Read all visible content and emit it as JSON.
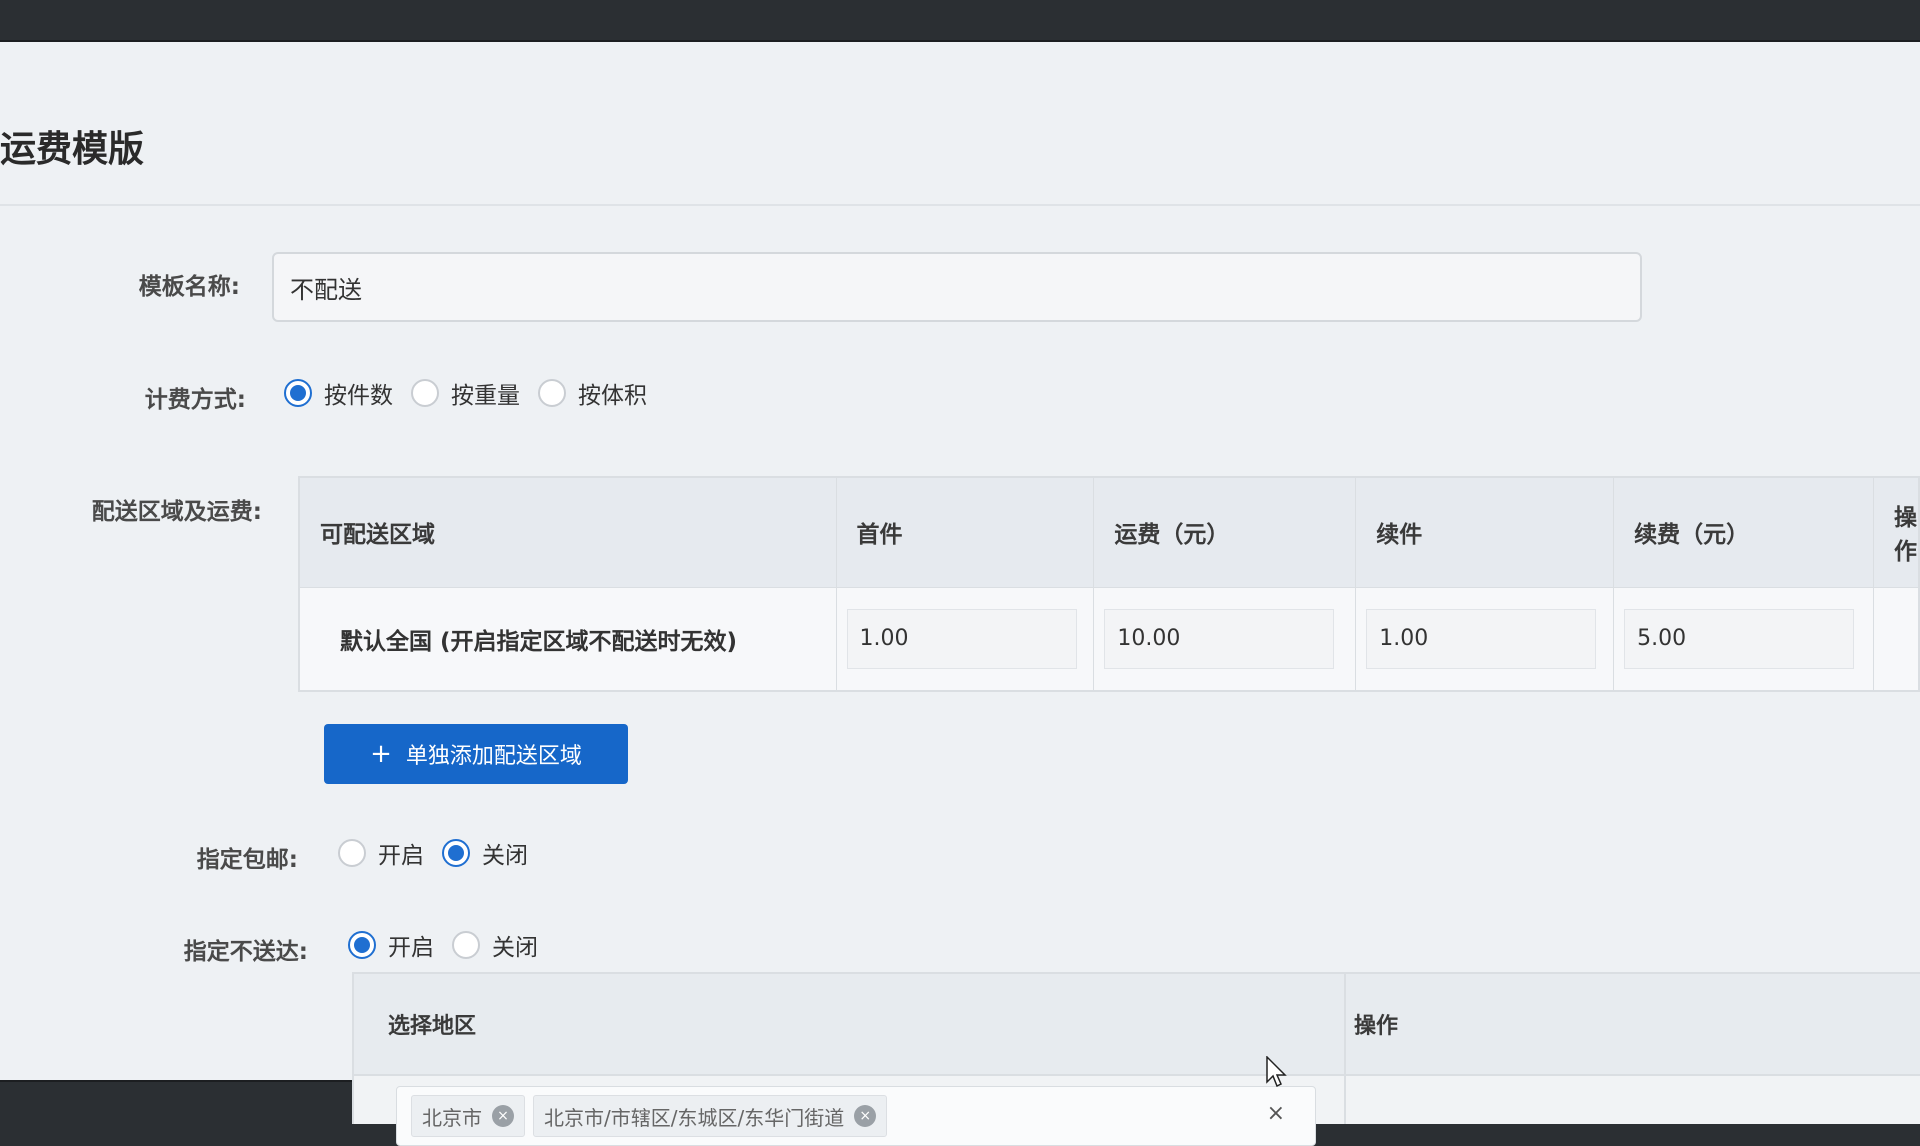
{
  "page": {
    "title": "运费模版"
  },
  "template_name": {
    "label": "模板名称:",
    "value": "不配送"
  },
  "billing": {
    "label": "计费方式:",
    "options": [
      {
        "text": "按件数",
        "checked": true
      },
      {
        "text": "按重量",
        "checked": false
      },
      {
        "text": "按体积",
        "checked": false
      }
    ]
  },
  "delivery": {
    "label": "配送区域及运费:",
    "headers": [
      "可配送区域",
      "首件",
      "运费（元）",
      "续件",
      "续费（元）",
      "操作"
    ],
    "rows": [
      {
        "area": "默认全国 (开启指定区域不配送时无效)",
        "first": "1.00",
        "fee": "10.00",
        "next": "1.00",
        "next_fee": "5.00"
      }
    ],
    "add_button": "单独添加配送区域"
  },
  "free_shipping": {
    "label": "指定包邮:",
    "options": [
      {
        "text": "开启",
        "checked": false
      },
      {
        "text": "关闭",
        "checked": true
      }
    ]
  },
  "no_delivery": {
    "label": "指定不送达:",
    "options": [
      {
        "text": "开启",
        "checked": true
      },
      {
        "text": "关闭",
        "checked": false
      }
    ],
    "headers": [
      "选择地区",
      "操作"
    ],
    "selected_tags": [
      "北京市",
      "北京市/市辖区/东城区/东华门街道"
    ],
    "clear_symbol": "×"
  },
  "colors": {
    "primary": "#1667c9",
    "radio": "#1f6fd1"
  }
}
